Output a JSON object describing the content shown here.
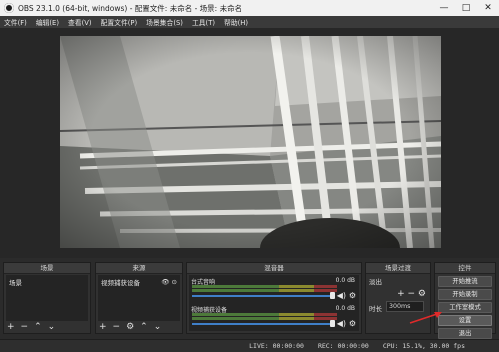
{
  "window": {
    "title": "OBS 23.1.0 (64-bit, windows) - 配置文件: 未命名 - 场景: 未命名",
    "minimize": "—",
    "maximize": "□",
    "close": "✕"
  },
  "menu": [
    "文件(F)",
    "编辑(E)",
    "查看(V)",
    "配置文件(P)",
    "场景集合(S)",
    "工具(T)",
    "帮助(H)"
  ],
  "docks": {
    "scenes": {
      "title": "场景",
      "items": [
        "场景"
      ]
    },
    "sources": {
      "title": "来源",
      "items": [
        "视频捕获设备"
      ]
    },
    "mixer": {
      "title": "混音器",
      "channels": [
        {
          "name": "台式音响",
          "db": "0.0 dB"
        },
        {
          "name": "视频捕获设备",
          "db": "0.0 dB"
        }
      ]
    },
    "transitions": {
      "title": "场景过渡",
      "type": "淡出",
      "duration_label": "时长",
      "duration_value": "300ms"
    },
    "controls": {
      "title": "控件",
      "buttons": [
        "开始推流",
        "开始录制",
        "工作室模式",
        "设置",
        "退出"
      ]
    }
  },
  "status": {
    "live": "LIVE: 00:00:00",
    "rec": "REC: 00:00:00",
    "cpu": "CPU: 15.1%, 30.00 fps"
  },
  "colors": {
    "accent": "#3f7fc8",
    "arrow": "#e02a2a"
  }
}
